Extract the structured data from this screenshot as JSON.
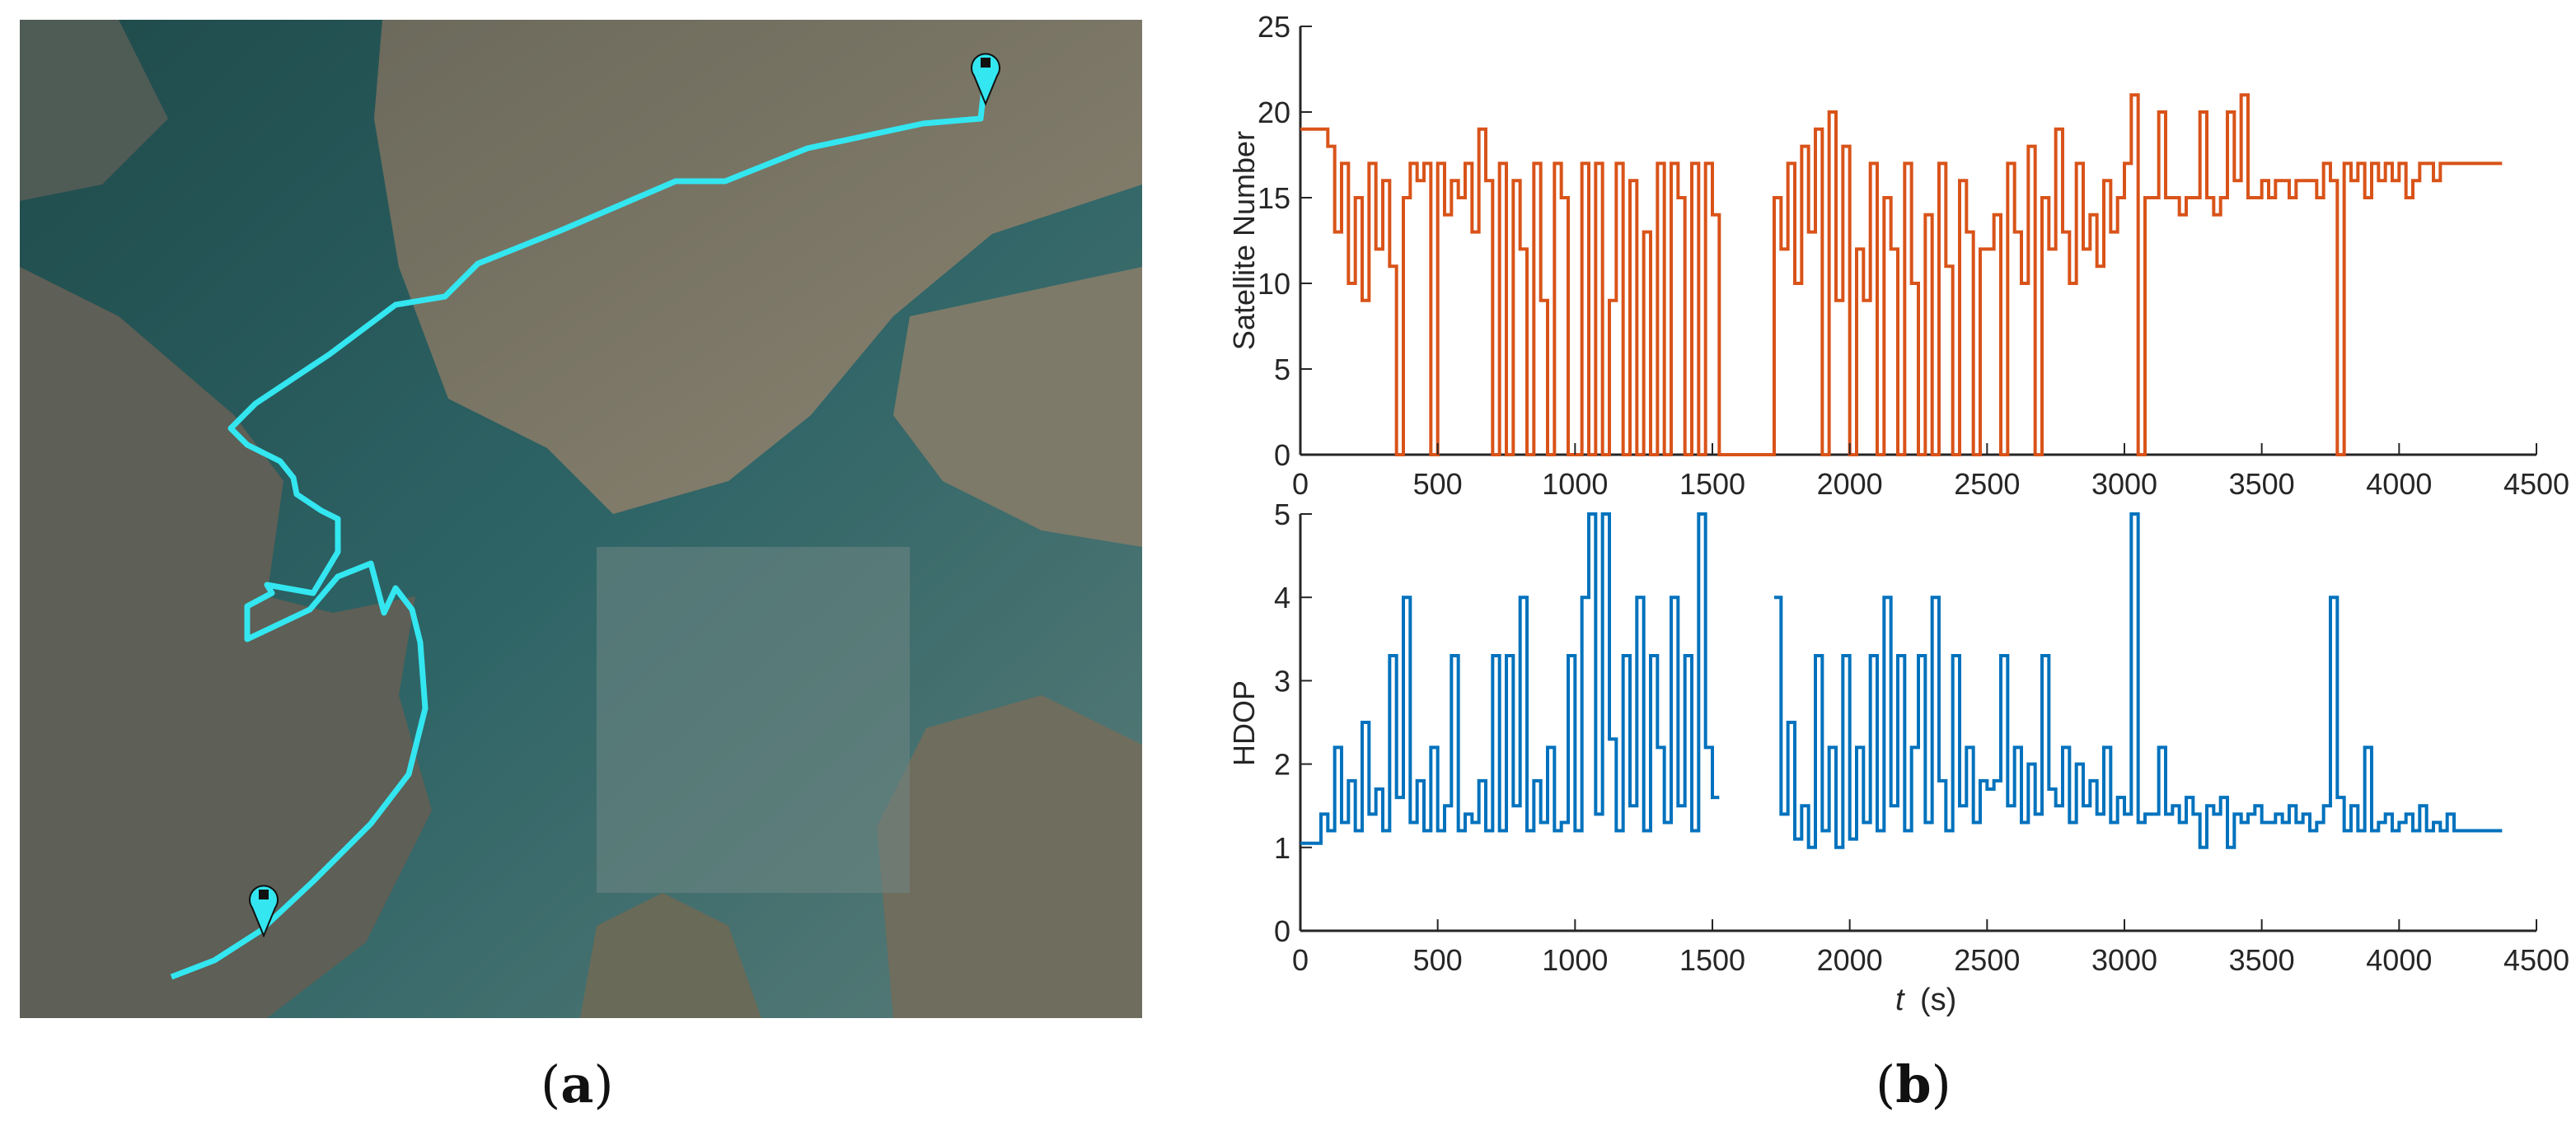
{
  "panel_a": {
    "caption_open": "(",
    "caption_letter": "a",
    "caption_close": ")",
    "route_color": "#33e6f0",
    "markers": [
      "start-pin",
      "end-pin"
    ]
  },
  "panel_b": {
    "caption_open": "(",
    "caption_letter": "b",
    "caption_close": ")"
  },
  "chart_data": [
    {
      "type": "line",
      "title": "",
      "xlabel": "",
      "ylabel": "Satellite Number",
      "xlim": [
        0,
        4500
      ],
      "ylim": [
        0,
        25
      ],
      "xticks": [
        0,
        500,
        1000,
        1500,
        2000,
        2500,
        3000,
        3500,
        4000,
        4500
      ],
      "yticks": [
        0,
        5,
        10,
        15,
        20,
        25
      ],
      "grid": false,
      "color": "#d95319",
      "x_step": 25,
      "values": [
        19,
        19,
        19,
        19,
        18,
        13,
        17,
        10,
        15,
        9,
        17,
        12,
        16,
        11,
        0,
        15,
        17,
        16,
        17,
        0,
        17,
        14,
        16,
        15,
        17,
        13,
        19,
        16,
        0,
        17,
        0,
        16,
        12,
        0,
        17,
        9,
        0,
        17,
        15,
        0,
        0,
        17,
        0,
        17,
        0,
        9,
        17,
        0,
        16,
        0,
        13,
        0,
        17,
        0,
        17,
        15,
        0,
        17,
        0,
        17,
        14,
        0,
        0,
        0,
        0,
        0,
        0,
        0,
        0,
        15,
        12,
        17,
        10,
        18,
        13,
        19,
        0,
        20,
        9,
        18,
        0,
        12,
        9,
        17,
        0,
        15,
        12,
        0,
        17,
        10,
        0,
        14,
        0,
        17,
        11,
        0,
        16,
        13,
        0,
        12,
        12,
        14,
        0,
        17,
        13,
        10,
        18,
        0,
        15,
        12,
        19,
        13,
        10,
        17,
        12,
        14,
        11,
        16,
        13,
        15,
        17,
        21,
        0,
        15,
        15,
        20,
        15,
        15,
        14,
        15,
        15,
        20,
        15,
        14,
        15,
        20,
        16,
        21,
        15,
        15,
        16,
        15,
        16,
        16,
        15,
        16,
        16,
        16,
        15,
        17,
        16,
        0,
        17,
        16,
        17,
        15,
        17,
        16,
        17,
        16,
        17,
        15,
        16,
        17,
        17,
        16,
        17,
        17,
        17,
        17,
        17,
        17,
        17,
        17,
        17
      ]
    },
    {
      "type": "line",
      "title": "",
      "xlabel_italic": "t",
      "xlabel_unit": "(s)",
      "ylabel": "HDOP",
      "xlim": [
        0,
        4500
      ],
      "ylim": [
        0,
        5
      ],
      "xticks": [
        0,
        500,
        1000,
        1500,
        2000,
        2500,
        3000,
        3500,
        4000,
        4500
      ],
      "yticks": [
        0,
        1,
        2,
        3,
        4,
        5
      ],
      "grid": false,
      "color": "#0072bd",
      "x_step": 25,
      "values": [
        1.05,
        1.05,
        1.05,
        1.4,
        1.2,
        2.2,
        1.3,
        1.8,
        1.2,
        2.5,
        1.4,
        1.7,
        1.2,
        3.3,
        1.6,
        4.0,
        1.3,
        1.8,
        1.2,
        2.2,
        1.2,
        1.5,
        3.3,
        1.2,
        1.4,
        1.3,
        1.8,
        1.2,
        3.3,
        1.2,
        3.3,
        1.5,
        4.0,
        1.2,
        1.8,
        1.3,
        2.2,
        1.2,
        1.3,
        3.3,
        1.2,
        4.0,
        5.0,
        1.4,
        5.0,
        2.3,
        1.2,
        3.3,
        1.5,
        4.0,
        1.2,
        3.3,
        2.2,
        1.3,
        4.0,
        1.5,
        3.3,
        1.2,
        5.0,
        2.2,
        1.6,
        null,
        null,
        null,
        null,
        null,
        null,
        null,
        null,
        4.0,
        1.4,
        2.5,
        1.1,
        1.5,
        1.0,
        3.3,
        1.2,
        2.2,
        1.0,
        3.3,
        1.1,
        2.2,
        1.3,
        3.3,
        1.2,
        4.0,
        1.5,
        3.3,
        1.2,
        2.2,
        3.3,
        1.3,
        4.0,
        1.8,
        1.2,
        3.3,
        1.5,
        2.2,
        1.3,
        1.8,
        1.7,
        1.8,
        3.3,
        1.5,
        2.2,
        1.3,
        2.0,
        1.4,
        3.3,
        1.7,
        1.5,
        2.2,
        1.3,
        2.0,
        1.5,
        1.8,
        1.4,
        2.2,
        1.3,
        1.6,
        1.4,
        5.0,
        1.3,
        1.4,
        1.4,
        2.2,
        1.4,
        1.5,
        1.3,
        1.6,
        1.4,
        1.0,
        1.5,
        1.4,
        1.6,
        1.0,
        1.4,
        1.3,
        1.4,
        1.5,
        1.3,
        1.3,
        1.4,
        1.3,
        1.5,
        1.3,
        1.4,
        1.2,
        1.3,
        1.5,
        4.0,
        1.6,
        1.2,
        1.5,
        1.2,
        2.2,
        1.2,
        1.3,
        1.4,
        1.2,
        1.3,
        1.4,
        1.2,
        1.5,
        1.2,
        1.3,
        1.2,
        1.4,
        1.2,
        1.2,
        1.2,
        1.2,
        1.2,
        1.2,
        1.2
      ]
    }
  ]
}
